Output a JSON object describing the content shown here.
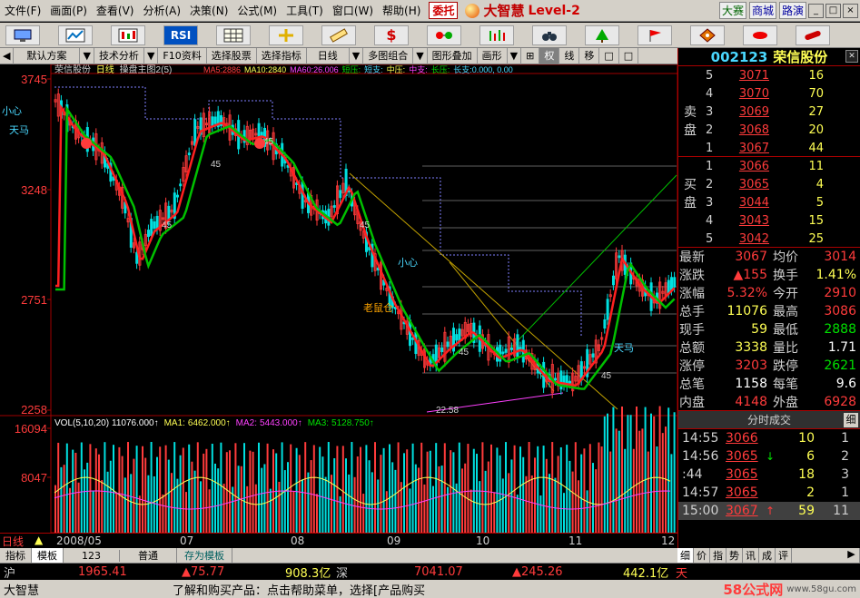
{
  "menubar": {
    "items": [
      "文件(F)",
      "画面(P)",
      "查看(V)",
      "分析(A)",
      "决策(N)",
      "公式(M)",
      "工具(T)",
      "窗口(W)",
      "帮助(H)"
    ],
    "entrust": "委托",
    "brand_name": "大智慧",
    "brand_level": "Level-2",
    "right_buttons": [
      "大赛",
      "商城",
      "路演"
    ],
    "window_controls": [
      "_",
      "□",
      "×"
    ]
  },
  "toolbar": {
    "icons": [
      "monitor-icon",
      "chart-icon",
      "kline-icon",
      "RSI",
      "grid-icon",
      "crosshair-icon",
      "ruler-icon",
      "$",
      "glasses-icon",
      "bars-icon",
      "binoculars-icon",
      "tree-icon",
      "flag-icon",
      "diamond-icon",
      "lips-icon",
      "pill-icon"
    ]
  },
  "subbar": {
    "items": [
      "◀",
      "默认方案",
      "▼",
      "技术分析",
      "▼",
      "F10资料",
      "选择股票",
      "选择指标",
      "日线",
      "▼",
      "多图组合",
      "▼",
      "图形叠加",
      "画形",
      "▼",
      "⊞",
      "权",
      "线",
      "移",
      "□",
      "□"
    ]
  },
  "chart": {
    "stock_name": "荣信股份",
    "period": "日线",
    "indicator": "操盘主图2(5)",
    "ma_line": [
      {
        "label": "MA5:",
        "value": "2886",
        "color": "#ff4040"
      },
      {
        "label": "MA10:",
        "value": "2840",
        "color": "#ffff54"
      },
      {
        "label": "MA60:",
        "value": "26.006",
        "color": "#ff40ff"
      },
      {
        "label": "短压:",
        "value": "",
        "color": "#00e000"
      },
      {
        "label": "短支:",
        "value": "",
        "color": "#4ad8ff"
      },
      {
        "label": "中压:",
        "value": "",
        "color": "#ffff54"
      },
      {
        "label": "中支:",
        "value": "",
        "color": "#ff40ff"
      },
      {
        "label": "长压:",
        "value": "",
        "color": "#00e000"
      },
      {
        "label": "长支:",
        "value": "0.000, 0.00",
        "color": "#4ad8ff"
      }
    ],
    "price_axis": [
      "3745",
      "3248",
      "2751",
      "2258"
    ],
    "vol_axis": [
      "16094",
      "8047"
    ],
    "vol_line": [
      {
        "label": "VOL(5,10,20)",
        "value": "11076.000↑",
        "color": "#ffffff"
      },
      {
        "label": "MA1:",
        "value": "6462.000↑",
        "color": "#ffff54"
      },
      {
        "label": "MA2:",
        "value": "5443.000↑",
        "color": "#ff40ff"
      },
      {
        "label": "MA3:",
        "value": "5128.750↑",
        "color": "#00e000"
      }
    ],
    "annotations": [
      "小心",
      "天马",
      "老鼠仓",
      "小心",
      "天马",
      "45",
      "45",
      "45",
      "45",
      "45",
      "45",
      "22.58"
    ],
    "dates": [
      "2008/05",
      "07",
      "08",
      "09",
      "10",
      "11",
      "12"
    ],
    "left_label": "日线"
  },
  "bottom_tabs": [
    "指标",
    "模板",
    "123",
    "普通",
    "存为模板"
  ],
  "right_panel": {
    "code": "002123",
    "name": "荣信股份",
    "sell_label": "卖盘",
    "buy_label": "买盘",
    "sell": [
      {
        "lv": "5",
        "price": "3071",
        "vol": "16"
      },
      {
        "lv": "4",
        "price": "3070",
        "vol": "70"
      },
      {
        "lv": "3",
        "price": "3069",
        "vol": "27"
      },
      {
        "lv": "2",
        "price": "3068",
        "vol": "20"
      },
      {
        "lv": "1",
        "price": "3067",
        "vol": "44"
      }
    ],
    "buy": [
      {
        "lv": "1",
        "price": "3066",
        "vol": "11"
      },
      {
        "lv": "2",
        "price": "3065",
        "vol": "4"
      },
      {
        "lv": "3",
        "price": "3044",
        "vol": "5"
      },
      {
        "lv": "4",
        "price": "3043",
        "vol": "15"
      },
      {
        "lv": "5",
        "price": "3042",
        "vol": "25"
      }
    ],
    "stats": [
      {
        "k": "最新",
        "v": "3067",
        "k2": "均价",
        "v2": "3014"
      },
      {
        "k": "涨跌",
        "v": "▲155",
        "k2": "换手",
        "v2": "1.41%"
      },
      {
        "k": "涨幅",
        "v": "5.32%",
        "k2": "今开",
        "v2": "2910"
      },
      {
        "k": "总手",
        "v": "11076",
        "k2": "最高",
        "v2": "3086"
      },
      {
        "k": "现手",
        "v": "59",
        "k2": "最低",
        "v2": "2888"
      },
      {
        "k": "总额",
        "v": "3338",
        "k2": "量比",
        "v2": "1.71"
      },
      {
        "k": "涨停",
        "v": "3203",
        "k2": "跌停",
        "v2": "2621"
      },
      {
        "k": "总笔",
        "v": "1158",
        "k2": "每笔",
        "v2": "9.6"
      },
      {
        "k": "内盘",
        "v": "4148",
        "k2": "外盘",
        "v2": "6928"
      }
    ],
    "trades_title": "分时成交",
    "trades_btn": "细",
    "trades": [
      {
        "t": "14:55",
        "p": "3066",
        "d": "",
        "q": "10",
        "n": "1"
      },
      {
        "t": "14:56",
        "p": "3065",
        "d": "↓",
        "q": "6",
        "n": "2"
      },
      {
        "t": ":44",
        "p": "3065",
        "d": "",
        "q": "18",
        "n": "3"
      },
      {
        "t": "14:57",
        "p": "3065",
        "d": "",
        "q": "2",
        "n": "1"
      },
      {
        "t": "15:00",
        "p": "3067",
        "d": "↑",
        "q": "59",
        "n": "11"
      }
    ],
    "tabs": [
      "细",
      "价",
      "指",
      "势",
      "讯",
      "成",
      "评",
      "▶"
    ]
  },
  "status1": {
    "market": "沪",
    "index": "1965.41",
    "change": "▲75.77",
    "amount": "908.3亿",
    "market2": "深",
    "index2": "7041.07",
    "change2": "▲245.26",
    "amount2": "442.1亿",
    "extra": "天"
  },
  "status2": {
    "app": "大智慧",
    "message": "了解和购买产品：点击帮助菜单，选择[产品购买",
    "watermark": "58公式网",
    "url": "www.58gu.com"
  },
  "colors": {
    "up": "#ff3b3b",
    "down": "#00e0e0",
    "ma5": "#ff2020",
    "ma10": "#00c000",
    "panel_bg": "#d4d0c8"
  }
}
